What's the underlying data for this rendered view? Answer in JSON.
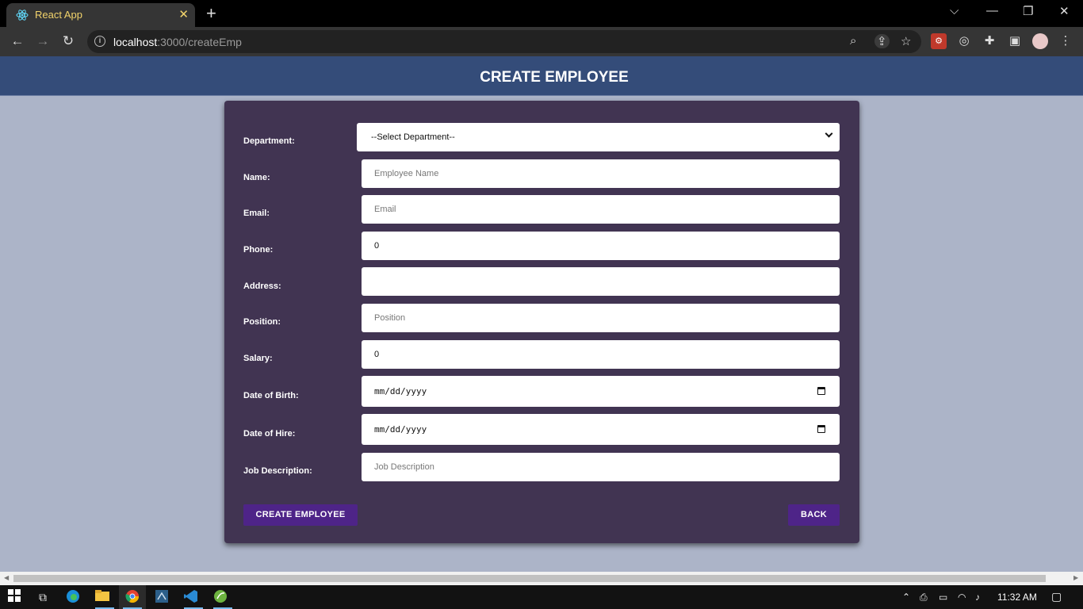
{
  "browser": {
    "tab_title": "React App",
    "tab_icon": "react-icon",
    "url_host": "localhost",
    "url_path": ":3000/createEmp",
    "window_controls": [
      "chevron-down-icon",
      "minimize-icon",
      "restore-icon",
      "close-icon"
    ]
  },
  "header": {
    "title": "CREATE EMPLOYEE"
  },
  "form": {
    "department": {
      "label": "Department:",
      "value": "--Select Department--"
    },
    "name": {
      "label": "Name:",
      "placeholder": "Employee Name"
    },
    "email": {
      "label": "Email:",
      "placeholder": "Email"
    },
    "phone": {
      "label": "Phone:",
      "value": "0"
    },
    "address": {
      "label": "Address:",
      "value": ""
    },
    "position": {
      "label": "Position:",
      "placeholder": "Position"
    },
    "salary": {
      "label": "Salary:",
      "value": "0"
    },
    "dob": {
      "label": "Date of Birth:",
      "value": "mm/dd/yyyy"
    },
    "doh": {
      "label": "Date of Hire:",
      "value": "mm/dd/yyyy"
    },
    "job_description": {
      "label": "Job Description:",
      "placeholder": "Job Description"
    },
    "create_button": "CREATE EMPLOYEE",
    "back_button": "BACK"
  },
  "taskbar": {
    "clock": "11:32 AM",
    "apps": [
      "windows-start-icon",
      "task-view-icon",
      "edge-icon",
      "file-explorer-icon",
      "chrome-icon",
      "sql-icon",
      "vscode-icon",
      "spring-icon"
    ]
  },
  "colors": {
    "header_bg": "#344c79",
    "card_bg": "#413452",
    "page_bg": "#acb4c8",
    "button_bg": "#4e2488"
  }
}
